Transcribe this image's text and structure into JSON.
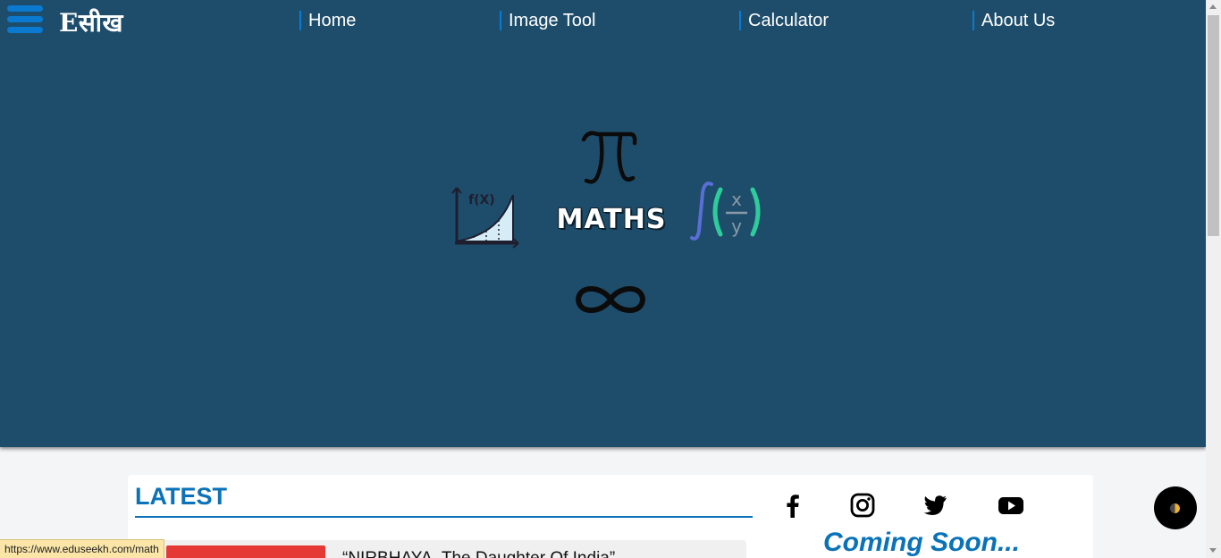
{
  "header": {
    "logo_text": "Eसीख",
    "nav": [
      {
        "label": "Home"
      },
      {
        "label": "Image Tool"
      },
      {
        "label": "Calculator"
      },
      {
        "label": "About Us"
      }
    ]
  },
  "hero": {
    "title": "MATHS",
    "graph_label": "f(X)",
    "integral_numerator": "x",
    "integral_denominator": "y",
    "icons": [
      "pi-icon",
      "function-graph-icon",
      "integral-icon",
      "infinity-icon"
    ]
  },
  "latest": {
    "heading": "LATEST",
    "articles": [
      {
        "title": "“NIRBHAYA, The Daughter Of India”"
      }
    ]
  },
  "sidebar": {
    "social_icons": [
      "facebook-icon",
      "instagram-icon",
      "twitter-icon",
      "youtube-icon"
    ],
    "coming_soon": "Coming Soon..."
  },
  "status_bar": {
    "url": "https://www.eduseekh.com/math"
  },
  "colors": {
    "hero_background": "#1e4d6b",
    "accent": "#0a72b8",
    "page_background": "#f4f5f7"
  }
}
